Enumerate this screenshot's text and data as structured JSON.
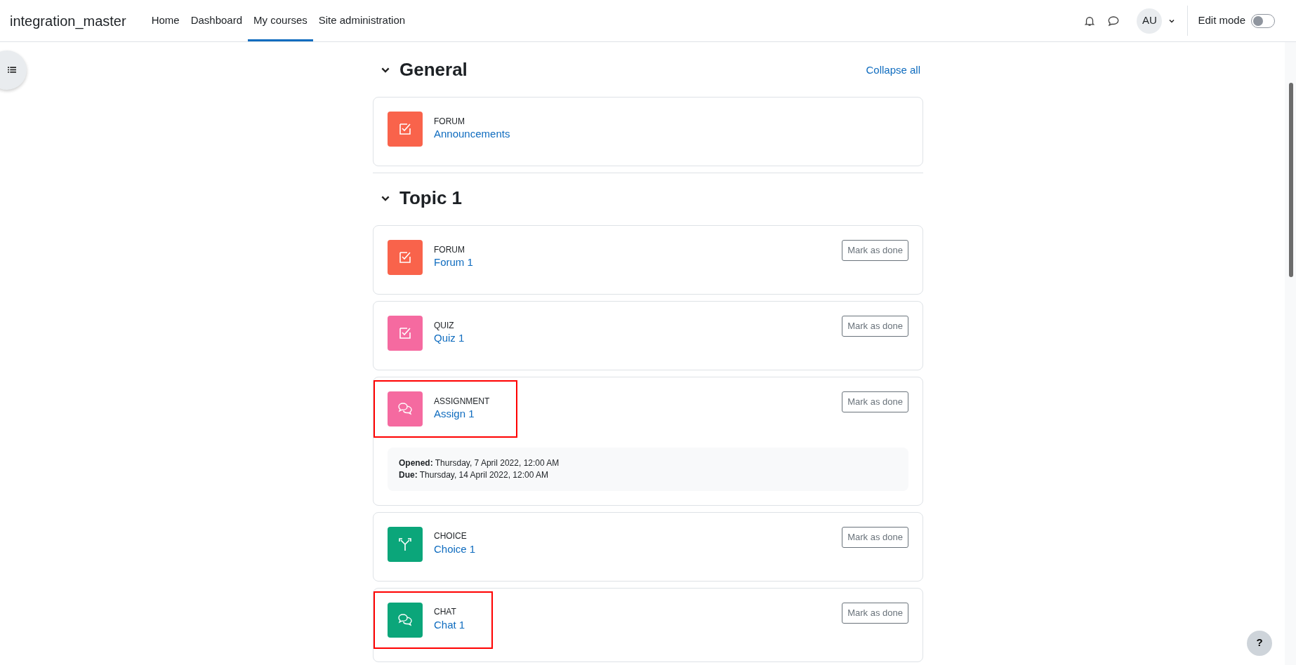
{
  "navbar": {
    "brand": "integration_master",
    "tabs": [
      {
        "label": "Home",
        "selected": false
      },
      {
        "label": "Dashboard",
        "selected": false
      },
      {
        "label": "My courses",
        "selected": true
      },
      {
        "label": "Site administration",
        "selected": false
      }
    ],
    "avatar": "AU",
    "edit_mode": {
      "label": "Edit mode",
      "on": false
    }
  },
  "collapse_all": "Collapse all",
  "sections": [
    {
      "title": "General",
      "expanded": true,
      "activities": [
        {
          "kind": "check",
          "color": "#f9634b",
          "type": "FORUM",
          "name": "Announcements",
          "highlighted": false
        }
      ]
    },
    {
      "title": "Topic 1",
      "expanded": true,
      "activities": [
        {
          "kind": "check",
          "color": "#f9634b",
          "type": "FORUM",
          "name": "Forum 1",
          "completion": "Mark as done",
          "highlighted": false
        },
        {
          "kind": "check",
          "color": "#f56aa0",
          "type": "QUIZ",
          "name": "Quiz 1",
          "completion": "Mark as done",
          "highlighted": false
        },
        {
          "kind": "chat",
          "color": "#f56aa0",
          "type": "ASSIGNMENT",
          "name": "Assign 1",
          "completion": "Mark as done",
          "highlighted": true,
          "dates": [
            "**Opened:** Thursday, 7 April 2022, 12:00 AM",
            "**Due:** Thursday, 14 April 2022, 12:00 AM"
          ]
        },
        {
          "kind": "choice",
          "color": "#0ba67a",
          "type": "CHOICE",
          "name": "Choice 1",
          "completion": "Mark as done",
          "highlighted": false
        },
        {
          "kind": "chat",
          "color": "#0ba67a",
          "type": "CHAT",
          "name": "Chat 1",
          "completion": "Mark as done",
          "highlighted": true
        }
      ]
    }
  ],
  "help": "?"
}
